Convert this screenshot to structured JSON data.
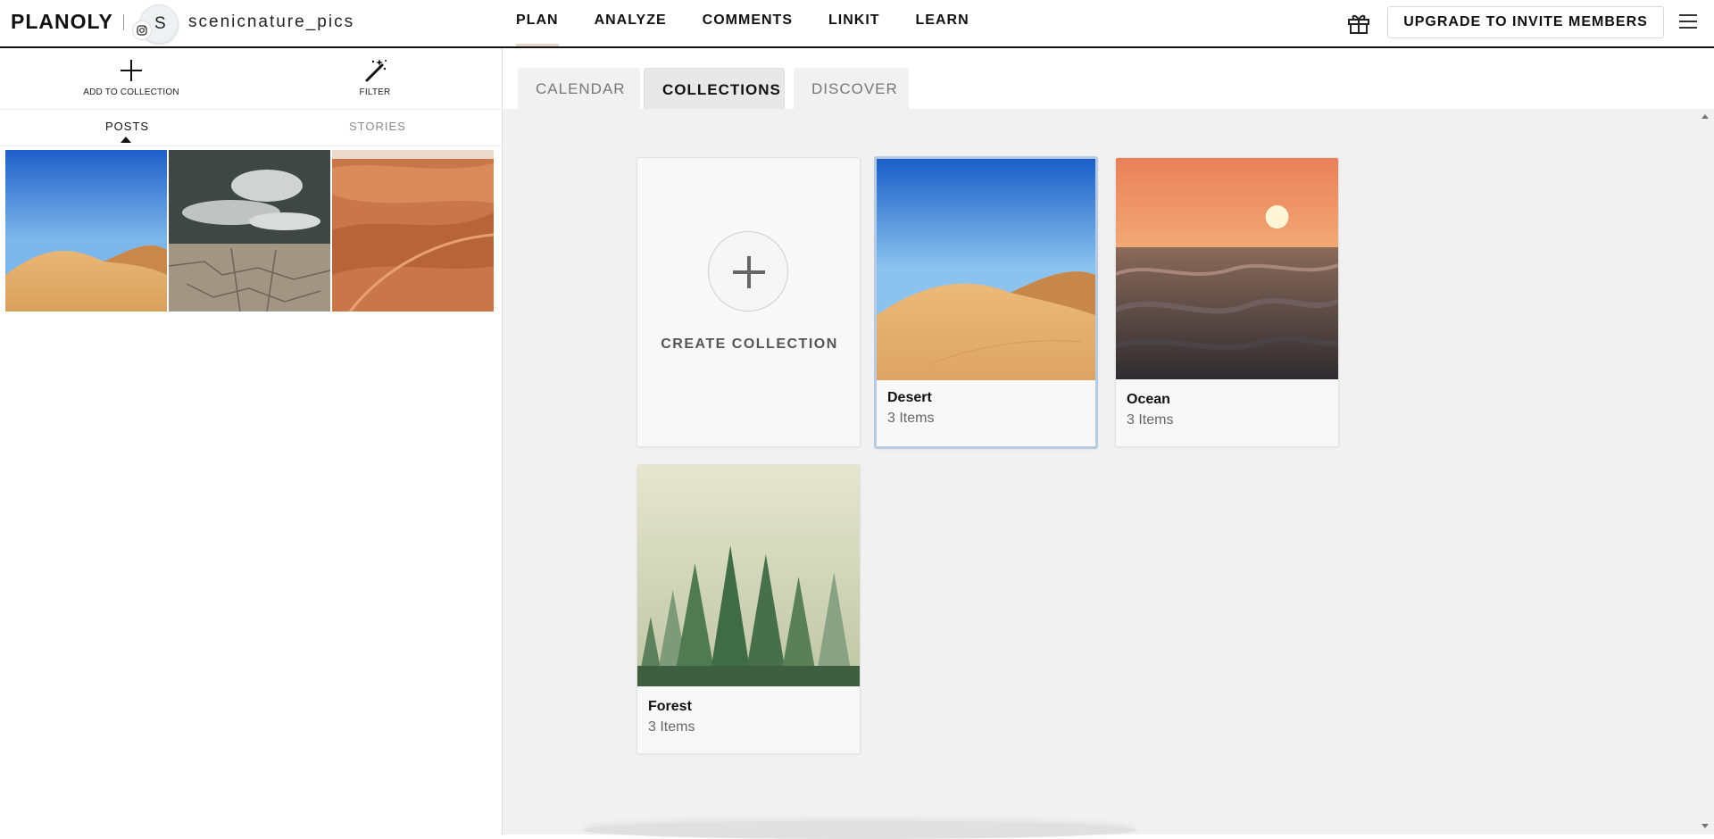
{
  "header": {
    "logo": "PLANOLY",
    "avatar_letter": "S",
    "account_name": "scenicnature_pics",
    "nav": [
      {
        "label": "PLAN",
        "active": true
      },
      {
        "label": "ANALYZE",
        "active": false
      },
      {
        "label": "COMMENTS",
        "active": false
      },
      {
        "label": "LINKIT",
        "active": false
      },
      {
        "label": "LEARN",
        "active": false
      }
    ],
    "upgrade_label": "UPGRADE TO INVITE MEMBERS",
    "icons": {
      "gift": "gift-icon",
      "menu": "hamburger-menu-icon",
      "instagram": "instagram-icon"
    }
  },
  "sidebar": {
    "add_to_collection_label": "ADD TO COLLECTION",
    "filter_label": "FILTER",
    "tabs": [
      {
        "label": "POSTS",
        "active": true
      },
      {
        "label": "STORIES",
        "active": false
      }
    ],
    "posts": [
      {
        "subject": "desert-dunes-blue-sky"
      },
      {
        "subject": "cracked-earth-clouds"
      },
      {
        "subject": "orange-sand-dunes"
      }
    ]
  },
  "main": {
    "tabs": [
      {
        "label": "CALENDAR",
        "active": false
      },
      {
        "label": "COLLECTIONS",
        "active": true
      },
      {
        "label": "DISCOVER",
        "active": false
      }
    ],
    "create_label": "CREATE COLLECTION",
    "collections": [
      {
        "name": "Desert",
        "count": "3 Items",
        "selected": true
      },
      {
        "name": "Ocean",
        "count": "3 Items",
        "selected": false
      },
      {
        "name": "Forest",
        "count": "3 Items",
        "selected": false
      }
    ]
  },
  "colors": {
    "accent_underline": "#e8d6c8",
    "selected_border": "#b8cbe4",
    "main_bg": "#f1f1f1"
  }
}
